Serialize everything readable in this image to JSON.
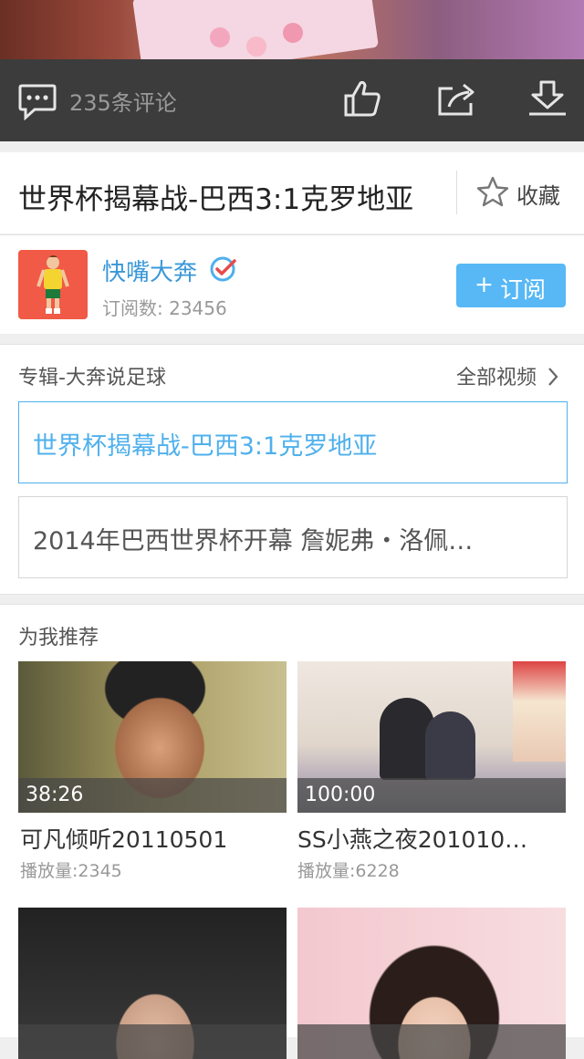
{
  "action_bar": {
    "comment_count": "235条评论",
    "icons": [
      "comment-icon",
      "thumbs-up-icon",
      "share-icon",
      "download-icon"
    ]
  },
  "video": {
    "title": "世界杯揭幕战-巴西3:1克罗地亚",
    "favorite_label": "收藏"
  },
  "channel": {
    "name": "快嘴大奔",
    "subscriber_count": "订阅数: 23456",
    "subscribe_label": "订阅",
    "subscribe_icon": "+"
  },
  "album": {
    "title": "专辑-大奔说足球",
    "all_videos_label": "全部视频",
    "items": [
      {
        "title": "世界杯揭幕战-巴西3:1克罗地亚",
        "selected": true
      },
      {
        "title": "2014年巴西世界杯开幕 詹妮弗・洛佩…",
        "selected": false
      }
    ]
  },
  "recommend": {
    "title": "为我推荐",
    "items": [
      {
        "duration": "38:26",
        "title": "可凡倾听20110501",
        "plays": "播放量:2345"
      },
      {
        "duration": "100:00",
        "title": "SS小燕之夜201010…",
        "plays": "播放量:6228"
      },
      {
        "duration": "",
        "title": "",
        "plays": ""
      },
      {
        "duration": "",
        "title": "",
        "plays": ""
      }
    ]
  },
  "colors": {
    "accent_blue": "#4fb0ec",
    "subscribe_button": "#57b8f5",
    "action_bar_bg": "#3c3c3c",
    "avatar_bg": "#f05a46"
  }
}
